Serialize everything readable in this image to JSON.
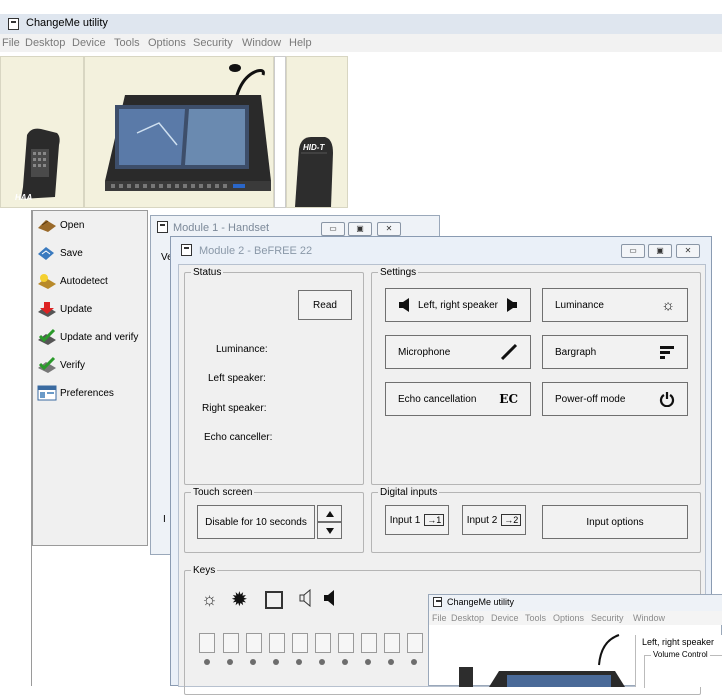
{
  "app": {
    "title": "ChangeMe utility"
  },
  "menu": [
    "File",
    "Desktop",
    "Device",
    "Tools",
    "Options",
    "Security",
    "Window",
    "Help"
  ],
  "devices": {
    "left_label": "HAA",
    "right_label": "HID-T"
  },
  "tools": [
    {
      "label": "Open",
      "icon": "open-icon"
    },
    {
      "label": "Save",
      "icon": "save-icon"
    },
    {
      "label": "Autodetect",
      "icon": "autodetect-icon"
    },
    {
      "label": "Update",
      "icon": "update-icon"
    },
    {
      "label": "Update and verify",
      "icon": "update-verify-icon"
    },
    {
      "label": "Verify",
      "icon": "verify-icon"
    },
    {
      "label": "Preferences",
      "icon": "preferences-icon"
    }
  ],
  "module1": {
    "title": "Module 1 - Handset",
    "stub": "Ve",
    "stub2": "I"
  },
  "module2": {
    "title": "Module 2 - BeFREE 22",
    "status": {
      "legend": "Status",
      "read": "Read",
      "labels": [
        "Luminance:",
        "Left speaker:",
        "Right speaker:",
        "Echo canceller:"
      ]
    },
    "settings": {
      "legend": "Settings",
      "buttons": [
        "Left, right speaker",
        "Luminance",
        "Microphone",
        "Bargraph",
        "Echo cancellation",
        "Power-off mode"
      ],
      "ec_text": "EC"
    },
    "touch": {
      "legend": "Touch screen",
      "value": "Disable for 10 seconds"
    },
    "digital": {
      "legend": "Digital inputs",
      "input1": "Input 1",
      "input2": "Input 2",
      "options": "Input options"
    },
    "keys": {
      "legend": "Keys"
    }
  },
  "thumb": {
    "title": "ChangeMe utility",
    "menu": [
      "File",
      "Desktop",
      "Device",
      "Tools",
      "Options",
      "Security",
      "Window"
    ],
    "tooltip": "Left, right speaker",
    "group": "Volume Control"
  }
}
